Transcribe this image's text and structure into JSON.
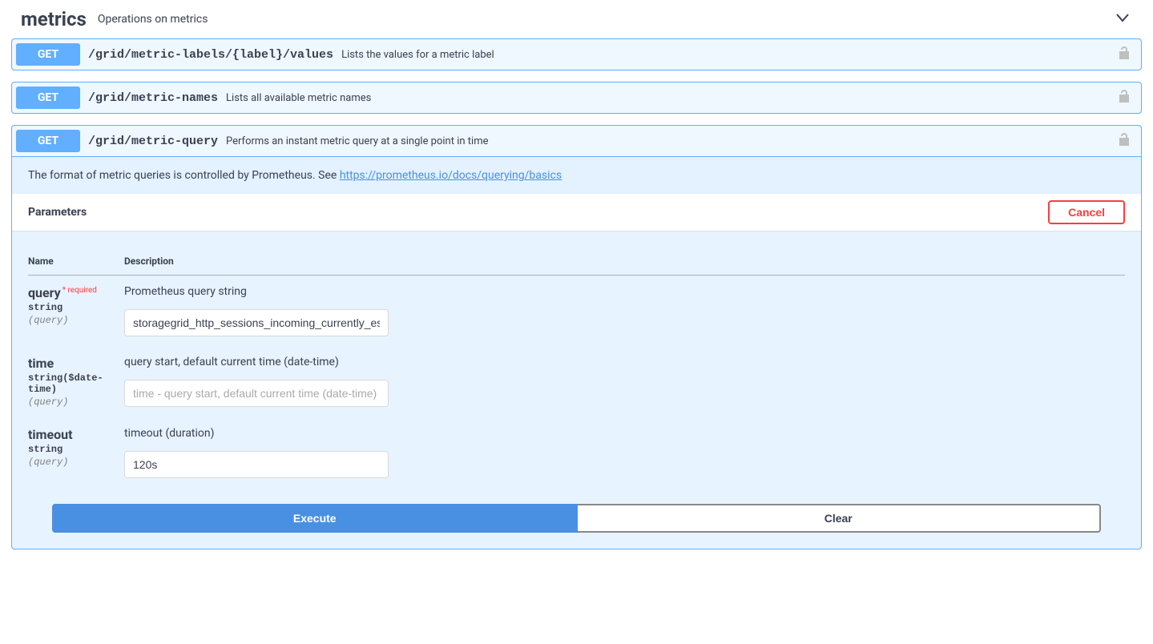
{
  "tag": {
    "name": "metrics",
    "description": "Operations on metrics"
  },
  "ops": [
    {
      "method": "GET",
      "path": "/grid/metric-labels/{label}/values",
      "summary": "Lists the values for a metric label"
    },
    {
      "method": "GET",
      "path": "/grid/metric-names",
      "summary": "Lists all available metric names"
    },
    {
      "method": "GET",
      "path": "/grid/metric-query",
      "summary": "Performs an instant metric query at a single point in time"
    }
  ],
  "expanded": {
    "description_prefix": "The format of metric queries is controlled by Prometheus. See ",
    "description_link": "https://prometheus.io/docs/querying/basics",
    "parameters_heading": "Parameters",
    "cancel_label": "Cancel",
    "table": {
      "name_header": "Name",
      "desc_header": "Description"
    },
    "params": [
      {
        "name": "query",
        "required_label": "* required",
        "type": "string",
        "location": "(query)",
        "description": "Prometheus query string",
        "value": "storagegrid_http_sessions_incoming_currently_established",
        "placeholder": ""
      },
      {
        "name": "time",
        "required_label": "",
        "type": "string($date-time)",
        "location": "(query)",
        "description": "query start, default current time (date-time)",
        "value": "",
        "placeholder": "time - query start, default current time (date-time)"
      },
      {
        "name": "timeout",
        "required_label": "",
        "type": "string",
        "location": "(query)",
        "description": "timeout (duration)",
        "value": "120s",
        "placeholder": ""
      }
    ],
    "execute_label": "Execute",
    "clear_label": "Clear"
  }
}
